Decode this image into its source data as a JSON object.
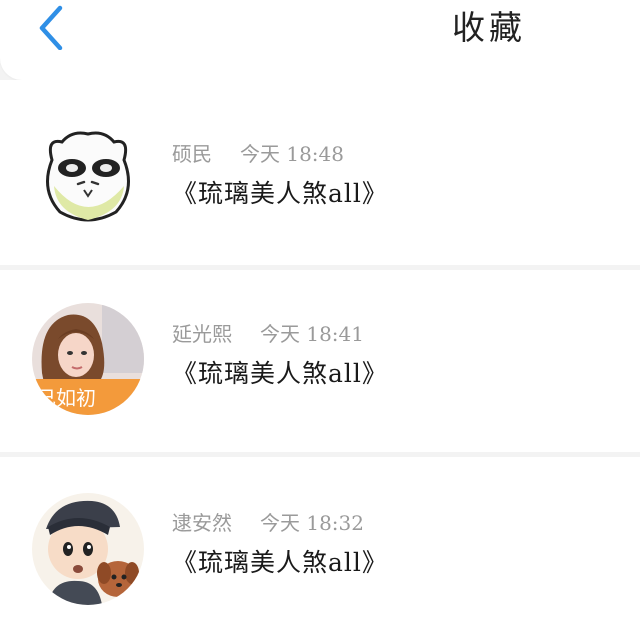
{
  "header": {
    "title": "收藏",
    "back_icon": "chevron-left-icon",
    "accent_color": "#2f8fe6"
  },
  "favorites": [
    {
      "author": "硕民",
      "time": "今天 18:48",
      "title": "《琉璃美人煞all》",
      "avatar_icon": "cartoon-face-avatar"
    },
    {
      "author": "延光熙",
      "time": "今天 18:41",
      "title": "《琉璃美人煞all》",
      "avatar_icon": "girl-photo-avatar",
      "avatar_caption": "己如初"
    },
    {
      "author": "逮安然",
      "time": "今天 18:32",
      "title": "《琉璃美人煞all》",
      "avatar_icon": "cartoon-boy-dog-avatar"
    }
  ]
}
